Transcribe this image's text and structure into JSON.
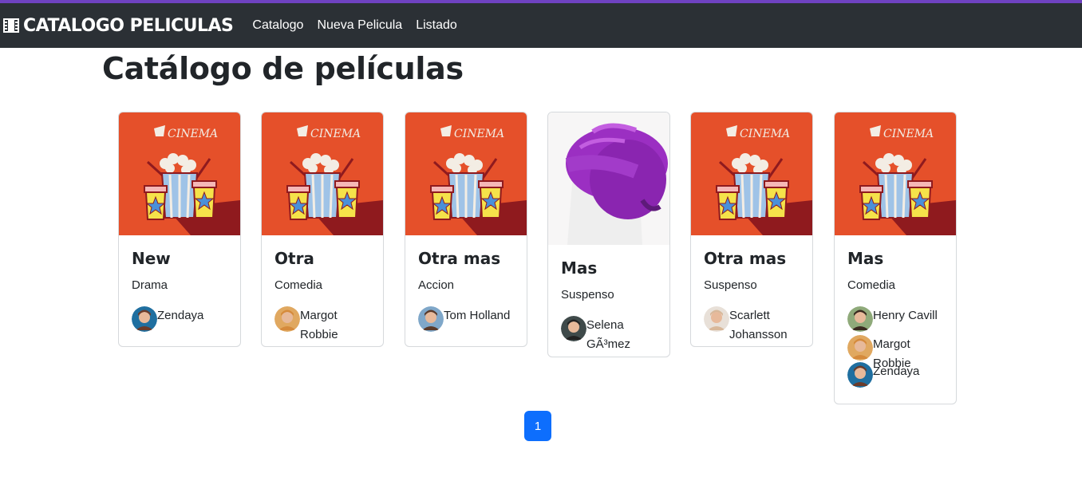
{
  "navbar": {
    "brand": "CATALOGO PELICULAS",
    "links": [
      "Catalogo",
      "Nueva Pelicula",
      "Listado"
    ]
  },
  "page_title": "Catálogo de películas",
  "movies": [
    {
      "title": "New",
      "genre": "Drama",
      "poster": "cinema-poster",
      "actors": [
        "Zendaya"
      ]
    },
    {
      "title": "Otra",
      "genre": "Comedia",
      "poster": "cinema-poster",
      "actors": [
        "Margot Robbie"
      ]
    },
    {
      "title": "Otra mas",
      "genre": "Accion",
      "poster": "cinema-poster",
      "actors": [
        "Tom Holland"
      ]
    },
    {
      "title": "Mas",
      "genre": "Suspenso",
      "poster": "purple-bonnet-photo",
      "actors": [
        "Selena GÃ³mez"
      ]
    },
    {
      "title": "Otra mas",
      "genre": "Suspenso",
      "poster": "cinema-poster",
      "actors": [
        "Scarlett Johansson"
      ]
    },
    {
      "title": "Mas",
      "genre": "Comedia",
      "poster": "cinema-poster",
      "actors": [
        "Henry Cavill",
        "Margot Robbie",
        "Zendaya"
      ]
    }
  ],
  "pagination": {
    "current": "1"
  },
  "colors": {
    "navbar": "#2b3035",
    "accent_line": "#6f42c1",
    "poster_orange": "#e5502a",
    "pagination_active": "#0d6efd"
  }
}
